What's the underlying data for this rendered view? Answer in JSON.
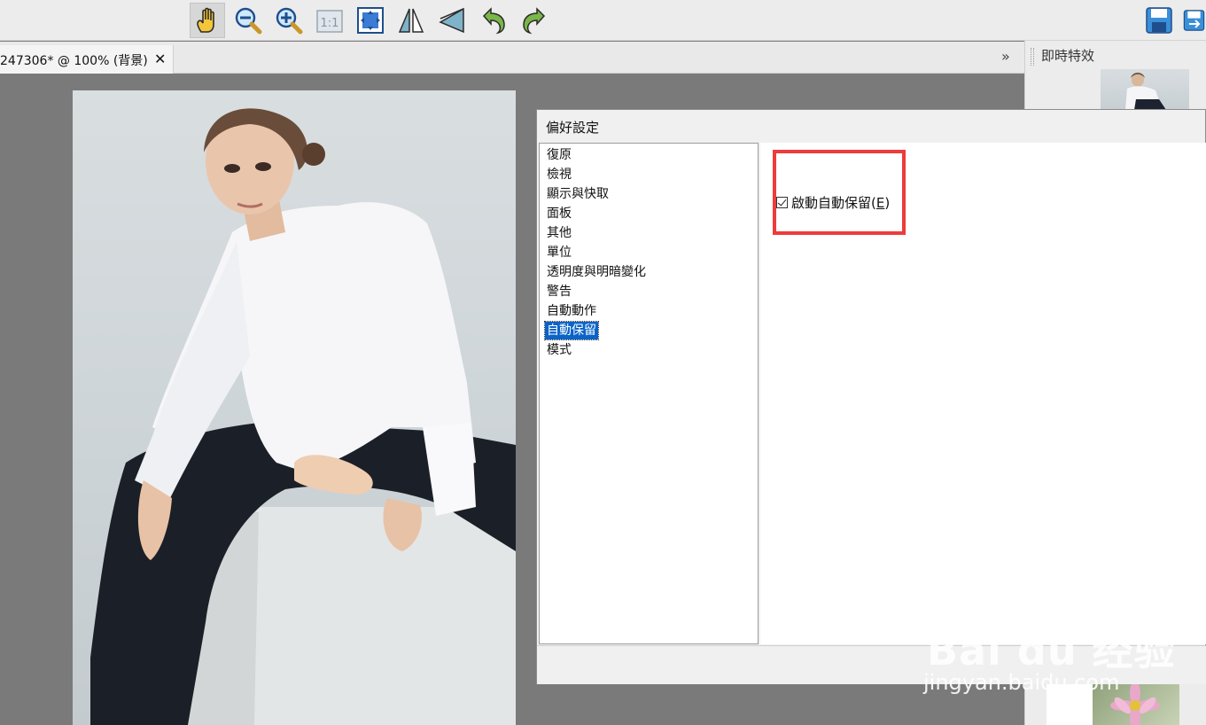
{
  "toolbar": {
    "tools": [
      {
        "name": "hand-tool",
        "icon": "hand-icon",
        "active": true
      },
      {
        "name": "zoom-out",
        "icon": "zoom-out-icon"
      },
      {
        "name": "zoom-in",
        "icon": "zoom-in-icon"
      },
      {
        "name": "actual-size",
        "icon": "actual-size-icon",
        "label": "1:1"
      },
      {
        "name": "fit-window",
        "icon": "fit-window-icon"
      },
      {
        "name": "flip-horizontal",
        "icon": "flip-horizontal-icon"
      },
      {
        "name": "flip-vertical",
        "icon": "flip-vertical-icon"
      },
      {
        "name": "rotate-left",
        "icon": "rotate-left-icon"
      },
      {
        "name": "rotate-right",
        "icon": "rotate-right-icon"
      }
    ],
    "right_tools": [
      {
        "name": "save",
        "icon": "save-icon"
      },
      {
        "name": "save-as",
        "icon": "save-as-icon"
      }
    ]
  },
  "document_tab": {
    "label": "247306* @ 100% (背景)",
    "close_glyph": "✕",
    "overflow_glyph": "»"
  },
  "right_panel": {
    "title": "即時特效"
  },
  "dialog": {
    "title": "偏好設定",
    "categories": [
      {
        "label": "復原"
      },
      {
        "label": "檢視"
      },
      {
        "label": "顯示與快取"
      },
      {
        "label": "面板"
      },
      {
        "label": "其他"
      },
      {
        "label": "單位"
      },
      {
        "label": "透明度與明暗變化"
      },
      {
        "label": "警告"
      },
      {
        "label": "自動動作"
      },
      {
        "label": "自動保留",
        "selected": true
      },
      {
        "label": "模式"
      }
    ],
    "autosave": {
      "checked": true,
      "label_text": "啟動自動保留(",
      "label_mnemonic": "E",
      "label_suffix": ")"
    }
  },
  "watermark": {
    "logo": "Bai du 经验",
    "url": "jingyan.baidu.com"
  },
  "colors": {
    "toolbar_bg": "#ececec",
    "workspace_bg": "#7a7a7a",
    "selection": "#0a64c8",
    "highlight_box": "#ee3b3b"
  }
}
